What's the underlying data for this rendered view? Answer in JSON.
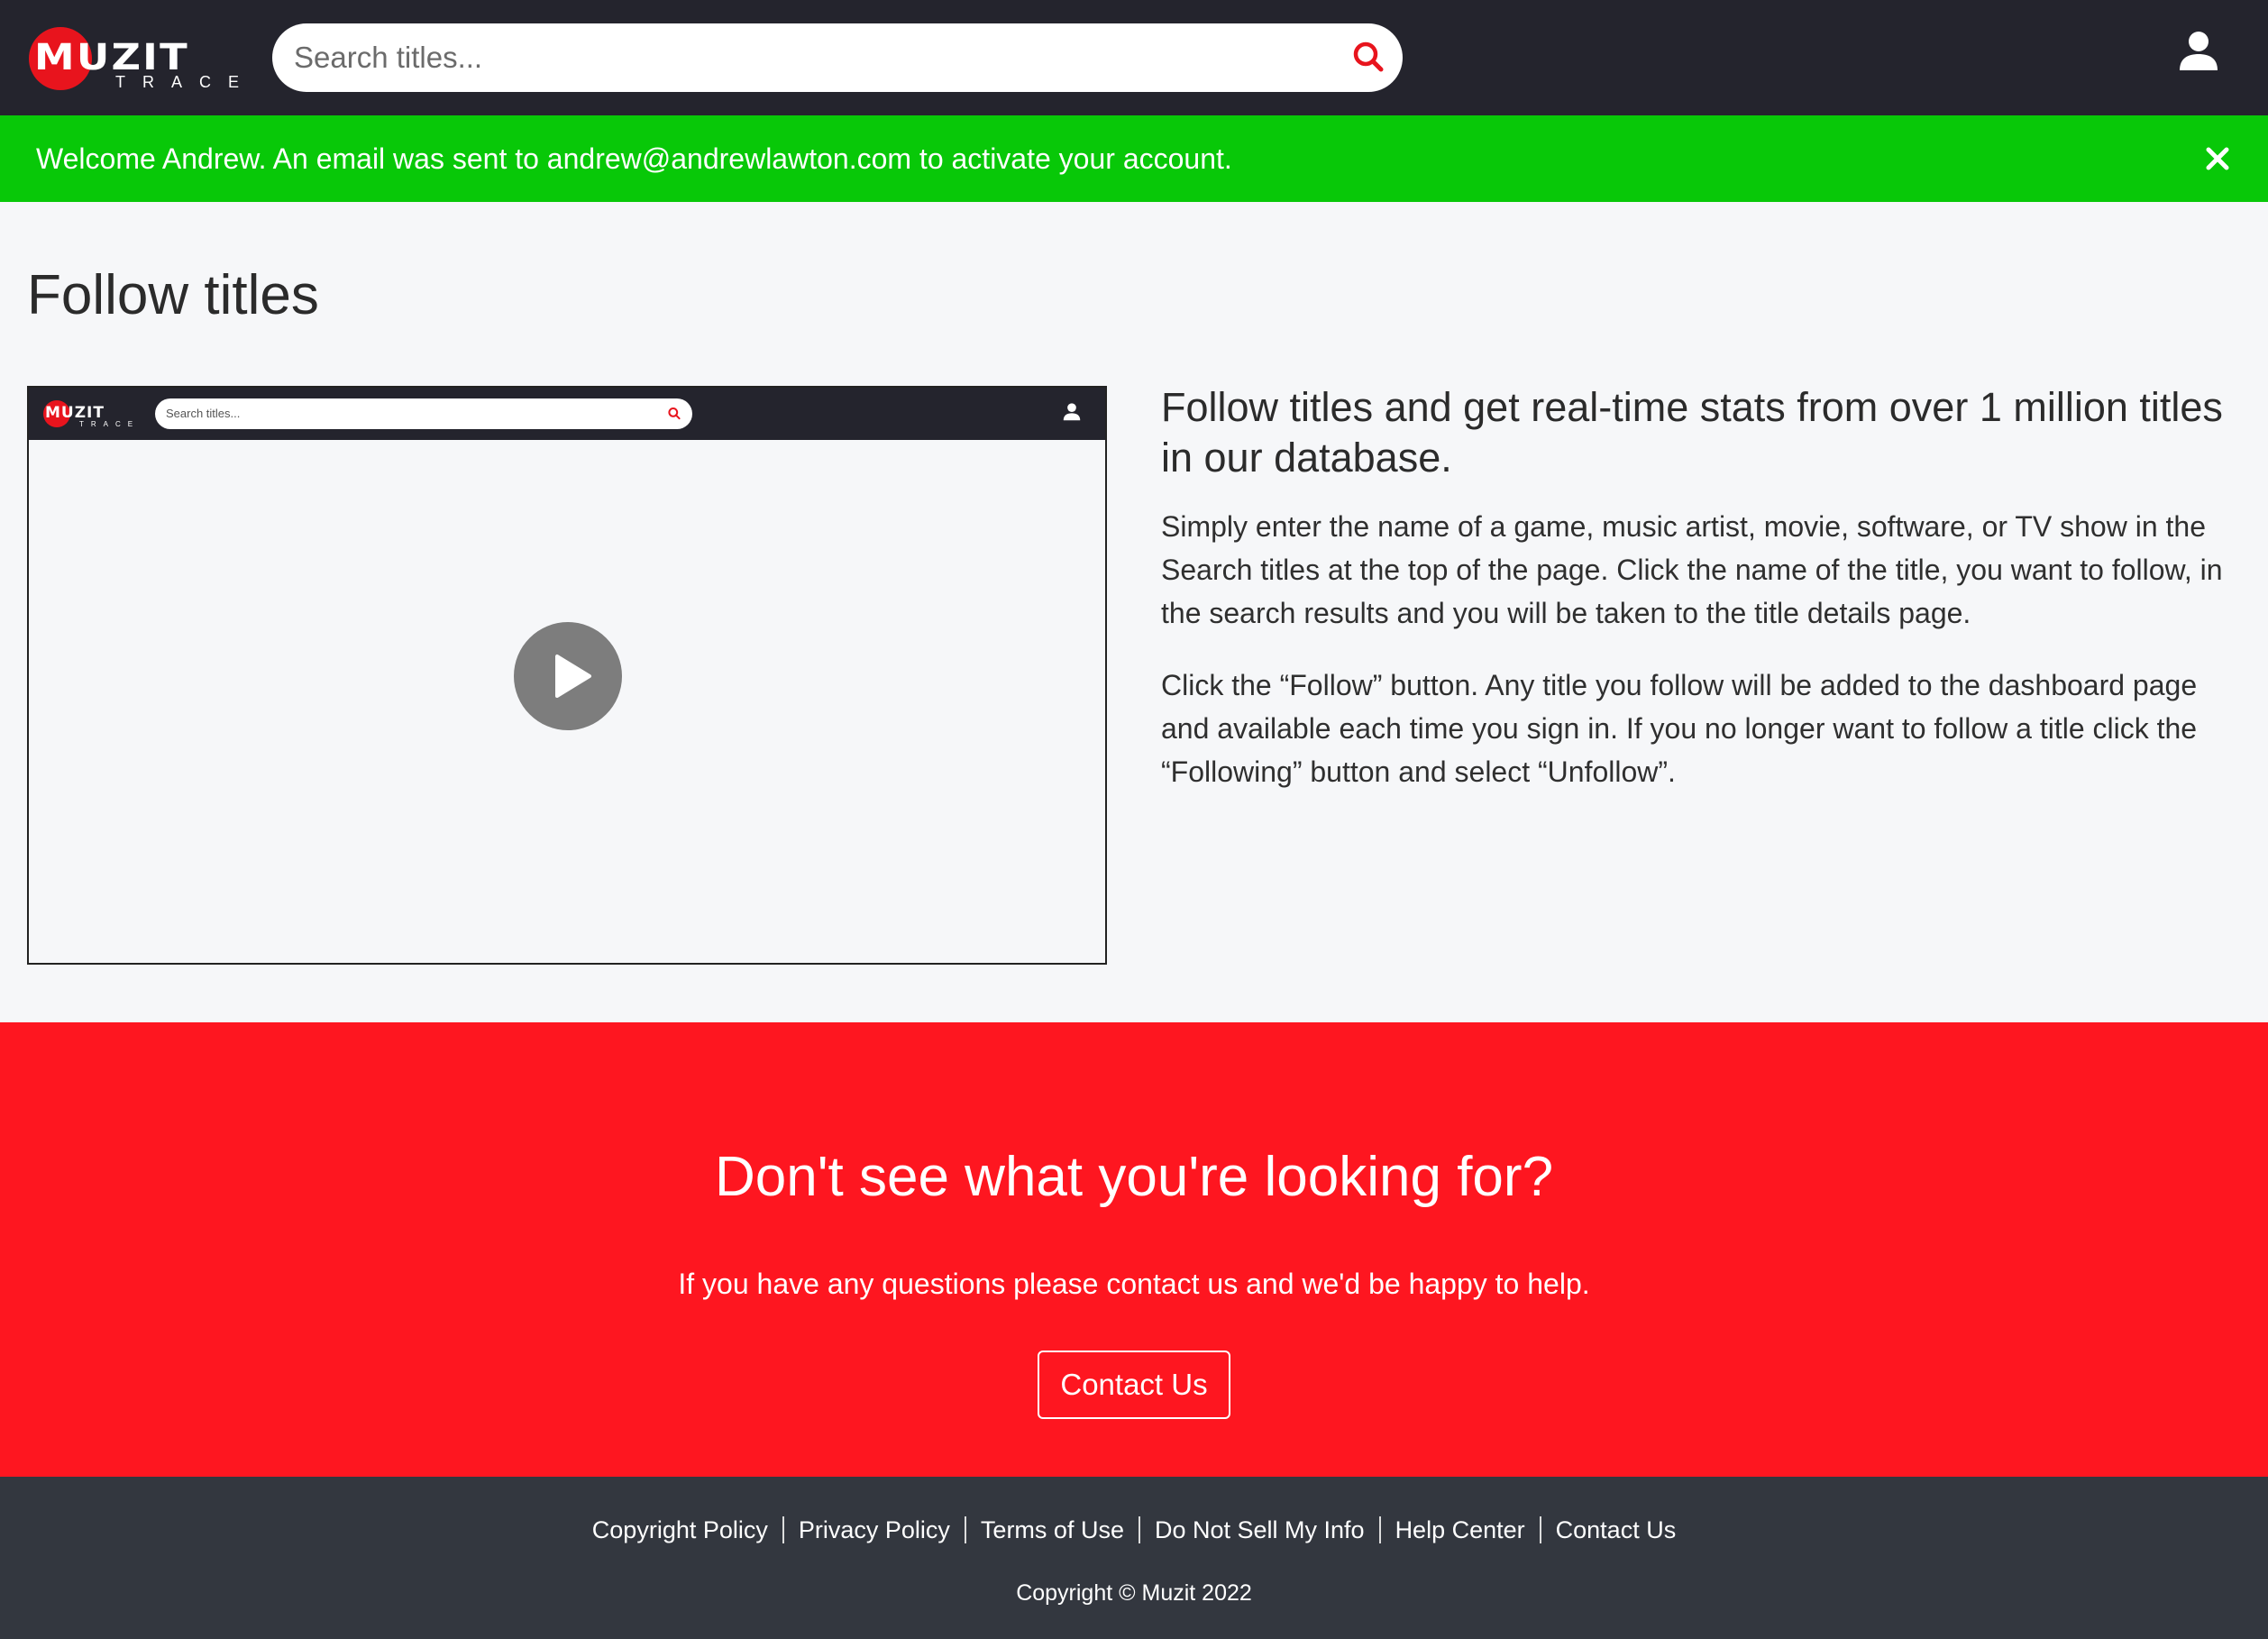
{
  "header": {
    "logo_text": "MUZIT",
    "logo_subtext": "TRACE",
    "search_placeholder": "Search titles...",
    "icons": {
      "search": "search-icon",
      "user": "user-icon"
    },
    "background": "#24242d"
  },
  "alert": {
    "message": "Welcome Andrew. An email was sent to andrew@andrewlawton.com to activate your account.",
    "close_icon": "close-icon",
    "color": "#08c808"
  },
  "main": {
    "title": "Follow titles",
    "video": {
      "mini_logo_text": "MUZIT",
      "mini_logo_subtext": "TRACE",
      "mini_search_placeholder": "Search titles...",
      "play_icon": "play-icon"
    },
    "heading": "Follow titles and get real-time stats from over 1 million titles in our database.",
    "paragraphs": [
      "Simply enter the name of a game, music artist, movie, software, or TV show in the Search titles at the top of the page. Click the name of the title, you want to follow, in the search results and you will be taken to the title details page.",
      "Click the “Follow” button. Any title you follow will be added to the dashboard page and available each time you sign in. If you no longer want to follow a title click the “Following” button and select “Unfollow”."
    ]
  },
  "cta": {
    "title": "Don't see what you're looking for?",
    "text": "If you have any questions please contact us and we'd be happy to help.",
    "button_label": "Contact Us",
    "color": "#fe1620"
  },
  "footer": {
    "links": [
      "Copyright Policy",
      "Privacy Policy",
      "Terms of Use",
      "Do Not Sell My Info",
      "Help Center",
      "Contact Us"
    ],
    "copyright": "Copyright © Muzit 2022",
    "background": "#33373f"
  }
}
